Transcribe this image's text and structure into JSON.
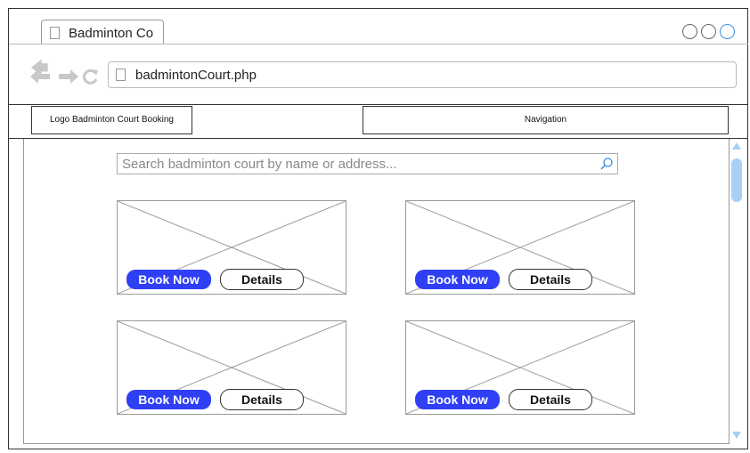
{
  "browser": {
    "tab_title": "Badminton Co",
    "url": "badmintonCourt.php"
  },
  "header": {
    "logo": "Logo Badminton Court Booking",
    "navigation": "Navigation"
  },
  "search": {
    "placeholder": "Search badminton court by name or address..."
  },
  "cards": [
    {
      "book_label": "Book Now",
      "details_label": "Details"
    },
    {
      "book_label": "Book Now",
      "details_label": "Details"
    },
    {
      "book_label": "Book Now",
      "details_label": "Details"
    },
    {
      "book_label": "Book Now",
      "details_label": "Details"
    }
  ],
  "colors": {
    "book_button": "#2f3ff5",
    "scrollbar": "#a7d0f5"
  }
}
